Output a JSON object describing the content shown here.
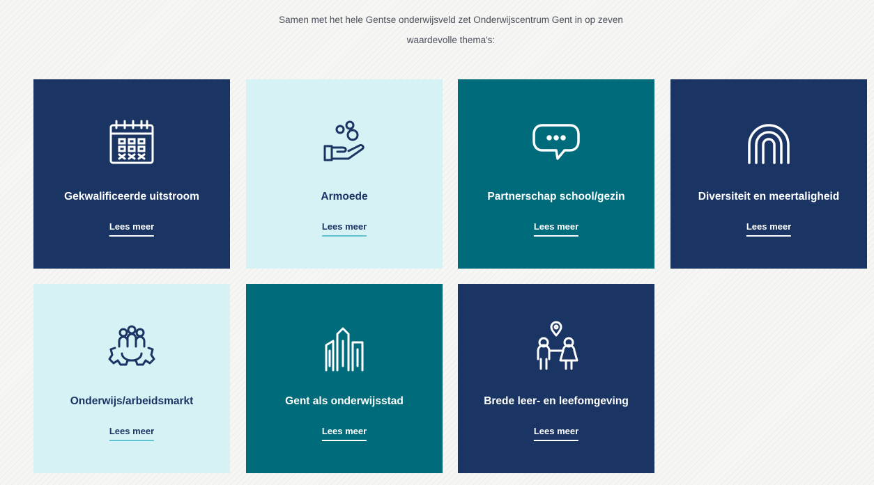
{
  "intro": {
    "line1": "Samen met het hele Gentse onderwijsveld zet Onderwijscentrum Gent in op zeven",
    "line2": "waardevolle thema's:"
  },
  "themes": [
    {
      "title": "Gekwalificeerde uitstroom",
      "link": "Lees meer",
      "icon": "calendar-icon",
      "style": "navy"
    },
    {
      "title": "Armoede",
      "link": "Lees meer",
      "icon": "hand-coins-icon",
      "style": "light"
    },
    {
      "title": "Partnerschap school/gezin",
      "link": "Lees meer",
      "icon": "speech-bubble-icon",
      "style": "teal"
    },
    {
      "title": "Diversiteit en meertaligheid",
      "link": "Lees meer",
      "icon": "rainbow-icon",
      "style": "navy"
    },
    {
      "title": "Onderwijs/arbeidsmarkt",
      "link": "Lees meer",
      "icon": "people-gear-icon",
      "style": "light"
    },
    {
      "title": "Gent als onderwijsstad",
      "link": "Lees meer",
      "icon": "city-buildings-icon",
      "style": "teal"
    },
    {
      "title": "Brede leer- en leefomgeving",
      "link": "Lees meer",
      "icon": "family-location-icon",
      "style": "navy"
    }
  ],
  "colors": {
    "navy": "#1a3563",
    "light": "#d7f2f5",
    "teal": "#006b7b",
    "underline_light": "#5dc5d2"
  }
}
